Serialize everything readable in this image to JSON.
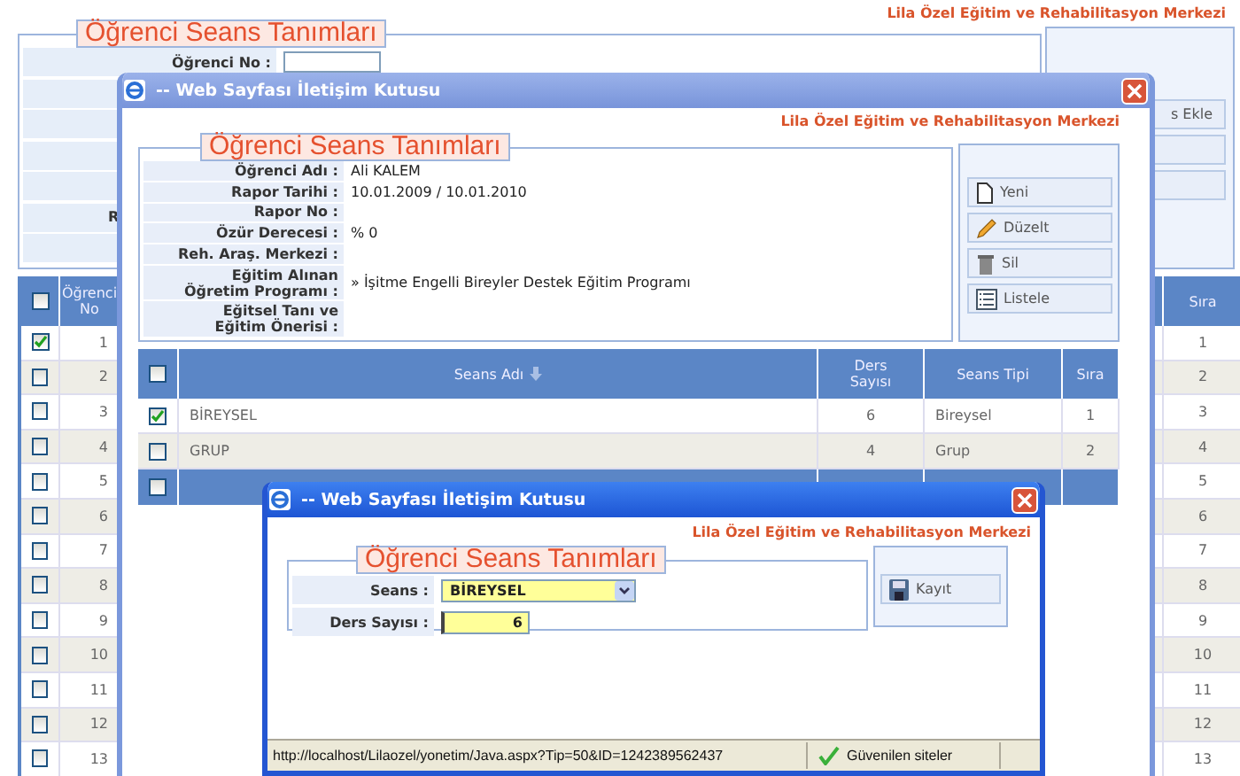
{
  "page": {
    "org_name": "Lila Özel Eğitim ve Rehabilitasyon Merkezi",
    "legend": "Öğrenci Seans Tanımları",
    "form_rows": [
      {
        "kind": "input",
        "label": "Öğrenci No :"
      },
      {
        "kind": "blank"
      },
      {
        "kind": "blank"
      },
      {
        "kind": "blank"
      },
      {
        "kind": "blank"
      },
      {
        "kind": "cut",
        "label": "R"
      },
      {
        "kind": "blank"
      }
    ],
    "side_buttons": [
      {
        "kind": "text",
        "label": "s Ekle"
      },
      {
        "kind": "blank"
      },
      {
        "kind": "blank"
      }
    ],
    "table": {
      "header_checked": false,
      "columns": [
        "Öğrenci\nNo",
        "Sıra"
      ],
      "rows": [
        {
          "checked": true,
          "no": "1",
          "order": "1"
        },
        {
          "checked": false,
          "no": "2",
          "order": "2"
        },
        {
          "checked": false,
          "no": "3",
          "order": "3"
        },
        {
          "checked": false,
          "no": "4",
          "order": "4"
        },
        {
          "checked": false,
          "no": "5",
          "order": "5"
        },
        {
          "checked": false,
          "no": "6",
          "order": "6"
        },
        {
          "checked": false,
          "no": "7",
          "order": "7"
        },
        {
          "checked": false,
          "no": "8",
          "order": "8"
        },
        {
          "checked": false,
          "no": "9",
          "order": "9"
        },
        {
          "checked": false,
          "no": "10",
          "order": "10"
        },
        {
          "checked": false,
          "no": "11",
          "order": "11"
        },
        {
          "checked": false,
          "no": "12",
          "order": "12"
        },
        {
          "checked": false,
          "no": "13",
          "order": "13"
        }
      ]
    }
  },
  "dialog": {
    "title": "-- Web Sayfası İletişim Kutusu",
    "org_name": "Lila Özel Eğitim ve Rehabilitasyon Merkezi",
    "legend": "Öğrenci Seans Tanımları",
    "details": [
      {
        "label": "Öğrenci Adı :",
        "value": "Ali KALEM"
      },
      {
        "label": "Rapor Tarihi :",
        "value": "10.01.2009 / 10.01.2010"
      },
      {
        "label": "Rapor No :"
      },
      {
        "label": "Özür Derecesi :",
        "value": "% 0"
      },
      {
        "label": "Reh. Araş. Merkezi :"
      },
      {
        "label": "Eğitim Alınan\nÖğretim Programı :",
        "value": "» İşitme Engelli Bireyler Destek Eğitim Programı"
      },
      {
        "label": "Eğitsel Tanı ve\nEğitim Önerisi :"
      }
    ],
    "buttons": [
      {
        "kind": "new",
        "label": "Yeni"
      },
      {
        "kind": "edit",
        "label": "Düzelt"
      },
      {
        "kind": "delete",
        "label": "Sil"
      },
      {
        "kind": "list",
        "label": "Listele"
      }
    ],
    "table": {
      "header_checked": false,
      "footer_checked": false,
      "columns": [
        {
          "label": "Seans Adı",
          "sortable": true
        },
        {
          "label": "Ders\nSayısı",
          "sortable": false
        },
        {
          "label": "Seans Tipi",
          "sortable": false
        },
        {
          "label": "Sıra",
          "sortable": false
        }
      ],
      "rows": [
        {
          "checked": true,
          "name": "BİREYSEL",
          "count": "6",
          "type": "Bireysel",
          "order": "1"
        },
        {
          "checked": false,
          "name": "GRUP",
          "count": "4",
          "type": "Grup",
          "order": "2"
        }
      ]
    }
  },
  "popup": {
    "title": "-- Web Sayfası İletişim Kutusu",
    "org_name": "Lila Özel Eğitim ve Rehabilitasyon Merkezi",
    "legend": "Öğrenci Seans Tanımları",
    "fields": [
      {
        "kind": "select",
        "label": "Seans :",
        "value": "BİREYSEL"
      },
      {
        "kind": "number",
        "label": "Ders Sayısı :",
        "value": "6"
      }
    ],
    "button": "Kayıt",
    "status": {
      "url": "http://localhost/Lilaozel/yonetim/Java.aspx?Tip=50&ID=1242389562437",
      "zone": "Güvenilen siteler"
    }
  }
}
